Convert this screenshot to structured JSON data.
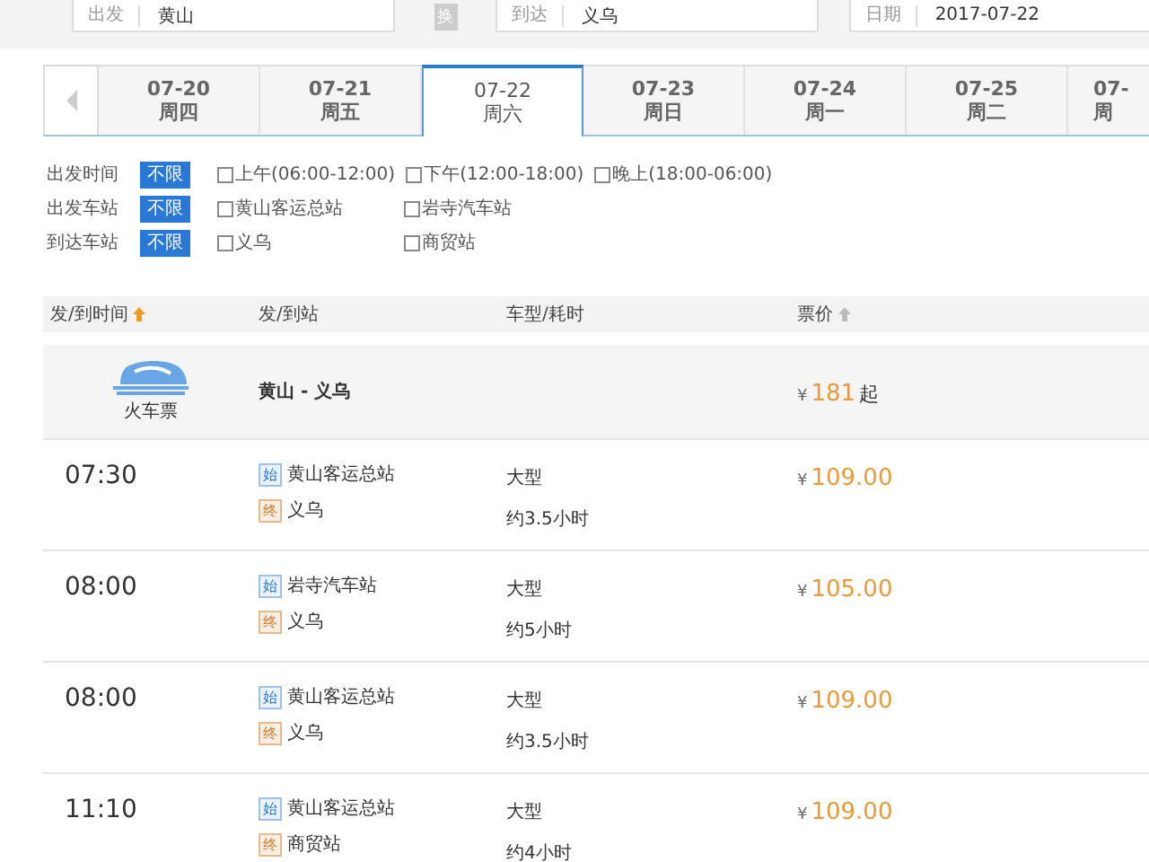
{
  "search": {
    "from": {
      "label": "出发",
      "value": "黄山"
    },
    "swap": "换",
    "to": {
      "label": "到达",
      "value": "义乌"
    },
    "date": {
      "label": "日期",
      "value": "2017-07-22"
    }
  },
  "date_tabs": [
    {
      "date": "07-20",
      "weekday": "周四",
      "selected": false
    },
    {
      "date": "07-21",
      "weekday": "周五",
      "selected": false
    },
    {
      "date": "07-22",
      "weekday": "周六",
      "selected": true
    },
    {
      "date": "07-23",
      "weekday": "周日",
      "selected": false
    },
    {
      "date": "07-24",
      "weekday": "周一",
      "selected": false
    },
    {
      "date": "07-25",
      "weekday": "周二",
      "selected": false
    },
    {
      "date": "07-",
      "weekday": "周",
      "selected": false
    }
  ],
  "filters": [
    {
      "label": "出发时间",
      "any": {
        "label": "不限",
        "selected": true
      },
      "options": [
        {
          "label": "上午(06:00-12:00)",
          "checked": false
        },
        {
          "label": "下午(12:00-18:00)",
          "checked": false
        },
        {
          "label": "晚上(18:00-06:00)",
          "checked": false
        }
      ]
    },
    {
      "label": "出发车站",
      "any": {
        "label": "不限",
        "selected": true
      },
      "options": [
        {
          "label": "黄山客运总站",
          "checked": false
        },
        {
          "label": "岩寺汽车站",
          "checked": false
        }
      ]
    },
    {
      "label": "到达车站",
      "any": {
        "label": "不限",
        "selected": true
      },
      "options": [
        {
          "label": "义乌",
          "checked": false
        },
        {
          "label": "商贸站",
          "checked": false
        }
      ]
    }
  ],
  "table": {
    "columns": [
      {
        "label": "发/到时间",
        "sort_active": true
      },
      {
        "label": "发/到站"
      },
      {
        "label": "车型/耗时"
      },
      {
        "label": "票价",
        "sort_active": false
      }
    ],
    "train_row": {
      "label": "火车票",
      "route": "黄山 - 义乌",
      "currency": "¥",
      "price": "181",
      "suffix": "起"
    },
    "rows": [
      {
        "time": "07:30",
        "from_tag": "始",
        "from": "黄山客运总站",
        "to_tag": "终",
        "to": "义乌",
        "bus_type": "大型",
        "duration": "约3.5小时",
        "currency": "¥",
        "price": "109.00"
      },
      {
        "time": "08:00",
        "from_tag": "始",
        "from": "岩寺汽车站",
        "to_tag": "终",
        "to": "义乌",
        "bus_type": "大型",
        "duration": "约5小时",
        "currency": "¥",
        "price": "105.00"
      },
      {
        "time": "08:00",
        "from_tag": "始",
        "from": "黄山客运总站",
        "to_tag": "终",
        "to": "义乌",
        "bus_type": "大型",
        "duration": "约3.5小时",
        "currency": "¥",
        "price": "109.00"
      },
      {
        "time": "11:10",
        "from_tag": "始",
        "from": "黄山客运总站",
        "to_tag": "终",
        "to": "商贸站",
        "bus_type": "大型",
        "duration": "约4小时",
        "currency": "¥",
        "price": "109.00"
      }
    ]
  }
}
